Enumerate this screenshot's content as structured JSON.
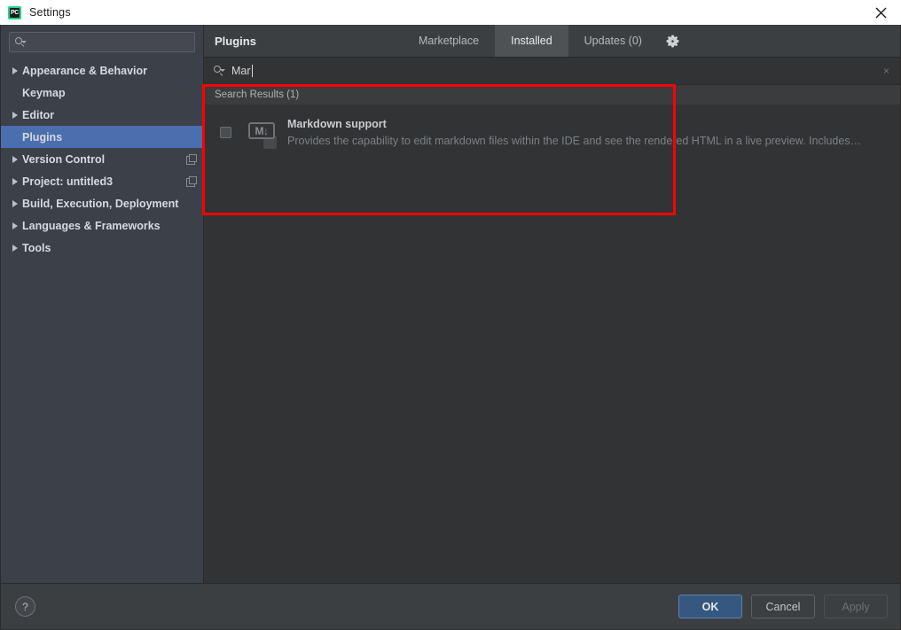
{
  "window": {
    "title": "Settings",
    "app_icon": "pycharm-icon",
    "app_icon_text": "PC",
    "close_icon": "close-icon"
  },
  "sidebar": {
    "search": {
      "value": "",
      "placeholder": "",
      "icon": "search-icon"
    },
    "items": [
      {
        "label": "Appearance & Behavior",
        "expandable": true,
        "selected": false,
        "trailing_icon": ""
      },
      {
        "label": "Keymap",
        "expandable": false,
        "selected": false,
        "trailing_icon": ""
      },
      {
        "label": "Editor",
        "expandable": true,
        "selected": false,
        "trailing_icon": ""
      },
      {
        "label": "Plugins",
        "expandable": false,
        "selected": true,
        "trailing_icon": ""
      },
      {
        "label": "Version Control",
        "expandable": true,
        "selected": false,
        "trailing_icon": "copy-icon"
      },
      {
        "label": "Project: untitled3",
        "expandable": true,
        "selected": false,
        "trailing_icon": "copy-icon"
      },
      {
        "label": "Build, Execution, Deployment",
        "expandable": true,
        "selected": false,
        "trailing_icon": ""
      },
      {
        "label": "Languages & Frameworks",
        "expandable": true,
        "selected": false,
        "trailing_icon": ""
      },
      {
        "label": "Tools",
        "expandable": true,
        "selected": false,
        "trailing_icon": ""
      }
    ]
  },
  "main": {
    "title": "Plugins",
    "tabs": [
      {
        "label": "Marketplace",
        "active": false
      },
      {
        "label": "Installed",
        "active": true
      },
      {
        "label": "Updates (0)",
        "active": false
      }
    ],
    "gear_icon": "gear-icon",
    "search": {
      "icon": "search-icon",
      "value": "Mar",
      "placeholder": "",
      "clear_icon": "clear-icon",
      "clear_label": "×"
    },
    "results": {
      "header": "Search Results (1)",
      "plugins": [
        {
          "name": "Markdown support",
          "description": "Provides the capability to edit markdown files within the IDE and see the rendered HTML in a live preview. Includes…",
          "icon": "markdown-icon",
          "icon_text": "M↓",
          "checked": false
        }
      ]
    },
    "highlight_color": "#ff0000"
  },
  "footer": {
    "help_label": "?",
    "buttons": [
      {
        "label": "OK",
        "style": "primary"
      },
      {
        "label": "Cancel",
        "style": "secondary"
      },
      {
        "label": "Apply",
        "style": "disabled"
      }
    ]
  },
  "colors": {
    "sidebar_bg": "#3c4049",
    "main_bg": "#313335",
    "header_bg": "#3c3f41",
    "selection_blue": "#4b6eaf",
    "primary_button": "#365880",
    "highlight_red": "#ff0000"
  }
}
